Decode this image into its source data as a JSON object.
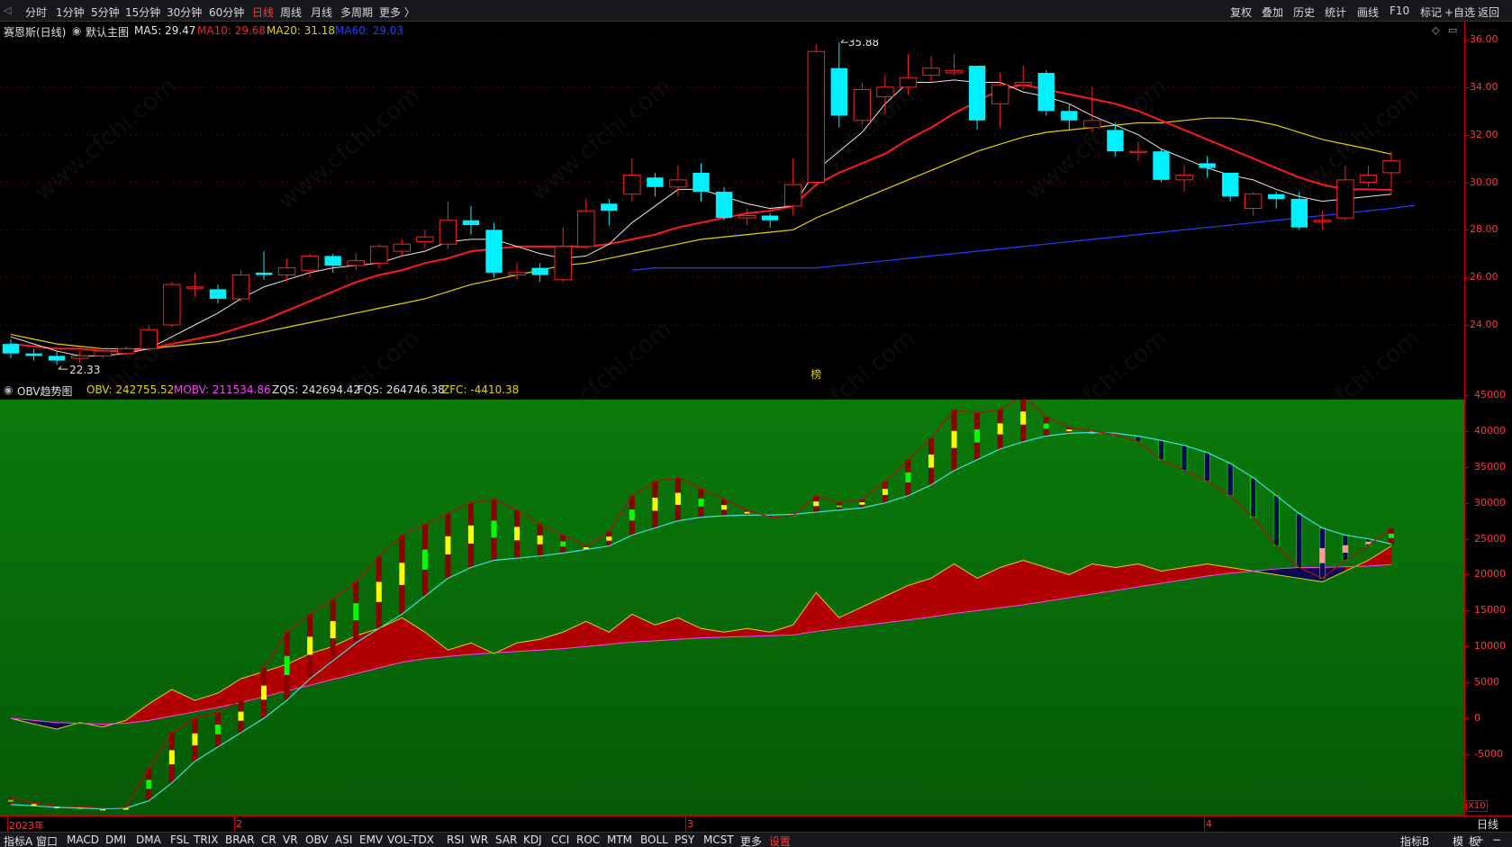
{
  "toolbar": {
    "periods": [
      "分时",
      "1分钟",
      "5分钟",
      "15分钟",
      "30分钟",
      "60分钟",
      "日线",
      "周线",
      "月线",
      "多周期",
      "更多 〉"
    ],
    "active_period": "日线",
    "right_items": [
      "复权",
      "叠加",
      "历史",
      "统计",
      "画线",
      "F10",
      "标记",
      "+自选",
      "返回"
    ]
  },
  "main_info": {
    "stock": "赛恩斯(日线)",
    "template": "默认主图",
    "ma5": "MA5: 29.47",
    "ma10": "MA10: 29.68",
    "ma20": "MA20: 31.18",
    "ma60": "MA60: 29.03"
  },
  "sub_info": {
    "name": "OBV趋势图",
    "obv": "OBV: 242755.52",
    "mobv": "MOBV: 211534.86",
    "zqs": "ZQS: 242694.42",
    "fqs": "FQS: 264746.38",
    "zfc": "ZFC: -4410.38"
  },
  "annotations": {
    "high": "35.88",
    "low": "22.33",
    "marker": "榜"
  },
  "watermark": "www.cfchi.com",
  "colors": {
    "up": "#ff2020",
    "down": "#00f0ff",
    "ma5": "#e6e6e6",
    "ma10": "#ff1a1a",
    "ma20": "#e6d200",
    "ma60": "#2040ff",
    "obv_bg_top": "#0a7a0a",
    "obv_bg_bottom": "#055a05",
    "obv_fill": "#b00000",
    "zqs": "#40e0e0",
    "fqs": "#b01010",
    "bar_yellow": "#ffff00",
    "bar_green": "#00ff00",
    "bar_darkred": "#8b0000",
    "bar_navy": "#0a0a50",
    "bar_pink": "#ff9a9a"
  },
  "date_axis": [
    "2023年",
    "2",
    "3",
    "4"
  ],
  "bottom": {
    "items": [
      "指标A",
      "窗口",
      "MACD",
      "DMI",
      "DMA",
      "FSL",
      "TRIX",
      "BRAR",
      "CR",
      "VR",
      "OBV",
      "ASI",
      "EMV",
      "VOL-TDX",
      "RSI",
      "WR",
      "SAR",
      "KDJ",
      "CCI",
      "ROC",
      "MTM",
      "BOLL",
      "PSY",
      "MCST",
      "更多",
      "设置"
    ],
    "active": "设置",
    "right_items": [
      "指标B",
      "模",
      "板",
      "+",
      "−"
    ],
    "day_button": "日线",
    "x10": "X10"
  },
  "chart_data": [
    {
      "type": "candlestick",
      "title": "赛恩斯(日线)",
      "ylim": [
        22,
        36.5
      ],
      "y_ticks": [
        24.0,
        26.0,
        28.0,
        30.0,
        32.0,
        34.0,
        36.0
      ],
      "y_tick_labels": [
        "24.00",
        "26.00",
        "28.00",
        "30.00",
        "32.00",
        "34.00",
        "36.00"
      ],
      "candles": [
        [
          23.2,
          22.8,
          23.4,
          22.6
        ],
        [
          22.8,
          22.7,
          23.0,
          22.5
        ],
        [
          22.7,
          22.5,
          22.9,
          22.33
        ],
        [
          22.6,
          22.7,
          22.9,
          22.4
        ],
        [
          22.7,
          22.9,
          23.0,
          22.6
        ],
        [
          22.8,
          23.0,
          23.1,
          22.7
        ],
        [
          23.0,
          23.8,
          24.0,
          22.9
        ],
        [
          24.0,
          25.7,
          25.8,
          23.9
        ],
        [
          25.6,
          25.6,
          26.2,
          25.2
        ],
        [
          25.5,
          25.1,
          25.7,
          24.9
        ],
        [
          25.1,
          26.1,
          26.3,
          25.0
        ],
        [
          26.2,
          26.1,
          27.1,
          25.9
        ],
        [
          26.1,
          26.4,
          26.8,
          25.8
        ],
        [
          26.3,
          26.9,
          27.0,
          26.0
        ],
        [
          26.9,
          26.5,
          27.0,
          26.2
        ],
        [
          26.5,
          26.7,
          27.0,
          26.3
        ],
        [
          26.6,
          27.3,
          27.4,
          26.4
        ],
        [
          27.1,
          27.4,
          27.6,
          26.9
        ],
        [
          27.5,
          27.7,
          28.0,
          27.2
        ],
        [
          27.4,
          28.4,
          29.2,
          27.2
        ],
        [
          28.4,
          28.2,
          29.0,
          27.8
        ],
        [
          28.0,
          26.2,
          28.3,
          26.0
        ],
        [
          26.1,
          26.2,
          26.6,
          25.9
        ],
        [
          26.4,
          26.1,
          26.6,
          25.8
        ],
        [
          25.9,
          27.3,
          28.1,
          25.8
        ],
        [
          27.3,
          28.8,
          29.3,
          27.2
        ],
        [
          29.1,
          28.8,
          29.3,
          28.2
        ],
        [
          29.5,
          30.3,
          31.0,
          29.2
        ],
        [
          30.2,
          29.8,
          30.4,
          29.4
        ],
        [
          29.8,
          30.1,
          30.7,
          29.4
        ],
        [
          30.4,
          29.6,
          30.8,
          29.2
        ],
        [
          29.6,
          28.5,
          29.8,
          28.4
        ],
        [
          28.5,
          28.6,
          28.9,
          28.2
        ],
        [
          28.6,
          28.4,
          28.7,
          28.1
        ],
        [
          29.0,
          29.9,
          31.0,
          28.6
        ],
        [
          30.0,
          35.5,
          35.8,
          29.8
        ],
        [
          34.8,
          32.8,
          35.88,
          32.3
        ],
        [
          32.6,
          33.9,
          34.2,
          32.4
        ],
        [
          33.6,
          34.0,
          34.5,
          32.9
        ],
        [
          34.0,
          34.4,
          35.4,
          33.7
        ],
        [
          34.5,
          34.8,
          35.3,
          34.2
        ],
        [
          34.6,
          34.7,
          35.4,
          34.5
        ],
        [
          34.9,
          32.6,
          34.9,
          32.2
        ],
        [
          33.3,
          34.1,
          34.6,
          32.3
        ],
        [
          34.1,
          34.2,
          34.9,
          33.9
        ],
        [
          34.6,
          33.0,
          34.7,
          32.8
        ],
        [
          33.0,
          32.6,
          33.3,
          32.2
        ],
        [
          32.3,
          32.6,
          34.0,
          32.1
        ],
        [
          32.2,
          31.3,
          32.5,
          31.1
        ],
        [
          31.3,
          31.3,
          31.7,
          30.9
        ],
        [
          31.3,
          30.1,
          31.4,
          30.0
        ],
        [
          30.1,
          30.3,
          30.7,
          29.6
        ],
        [
          30.8,
          30.6,
          31.1,
          30.2
        ],
        [
          30.4,
          29.4,
          30.4,
          29.2
        ],
        [
          28.9,
          29.5,
          29.6,
          28.6
        ],
        [
          29.5,
          29.3,
          29.6,
          28.9
        ],
        [
          29.3,
          28.1,
          29.6,
          28.0
        ],
        [
          28.4,
          28.4,
          28.8,
          28.0
        ],
        [
          28.5,
          30.1,
          30.7,
          28.4
        ],
        [
          30.0,
          30.3,
          30.7,
          29.8
        ],
        [
          30.4,
          30.9,
          31.3,
          29.5
        ]
      ],
      "ma5": [
        23.5,
        23.2,
        22.9,
        22.7,
        22.7,
        22.8,
        23.0,
        23.5,
        24.0,
        24.5,
        25.1,
        25.6,
        25.9,
        26.2,
        26.4,
        26.5,
        26.6,
        26.9,
        27.1,
        27.5,
        27.6,
        27.6,
        27.3,
        27.0,
        26.8,
        26.9,
        27.4,
        28.3,
        29.0,
        29.7,
        29.7,
        29.4,
        29.1,
        28.9,
        29.0,
        30.5,
        31.3,
        32.1,
        33.3,
        34.2,
        34.2,
        34.3,
        34.2,
        34.2,
        33.8,
        33.6,
        33.3,
        32.8,
        32.4,
        32.0,
        31.4,
        31.0,
        30.6,
        30.3,
        30.1,
        29.7,
        29.4,
        29.2,
        29.3,
        29.4,
        29.5
      ],
      "ma10": [
        23.2,
        23.1,
        23.0,
        23.0,
        22.9,
        22.9,
        23.0,
        23.2,
        23.4,
        23.6,
        23.9,
        24.2,
        24.6,
        25.0,
        25.4,
        25.8,
        26.1,
        26.3,
        26.6,
        26.8,
        27.1,
        27.2,
        27.3,
        27.3,
        27.3,
        27.3,
        27.4,
        27.6,
        27.8,
        28.1,
        28.3,
        28.5,
        28.7,
        28.8,
        29.0,
        29.9,
        30.4,
        30.8,
        31.2,
        31.8,
        32.3,
        32.9,
        33.4,
        33.9,
        34.1,
        33.9,
        33.7,
        33.5,
        33.3,
        33.0,
        32.6,
        32.2,
        31.8,
        31.4,
        31.0,
        30.6,
        30.2,
        29.9,
        29.7,
        29.7,
        29.68
      ],
      "ma20": [
        23.6,
        23.4,
        23.2,
        23.1,
        23.0,
        23.0,
        23.0,
        23.1,
        23.2,
        23.3,
        23.5,
        23.7,
        23.9,
        24.1,
        24.3,
        24.5,
        24.7,
        24.9,
        25.1,
        25.4,
        25.7,
        25.9,
        26.1,
        26.3,
        26.5,
        26.6,
        26.8,
        27.0,
        27.2,
        27.4,
        27.6,
        27.7,
        27.8,
        27.9,
        28.0,
        28.5,
        28.9,
        29.3,
        29.7,
        30.1,
        30.5,
        30.9,
        31.3,
        31.6,
        31.9,
        32.1,
        32.2,
        32.3,
        32.4,
        32.5,
        32.5,
        32.6,
        32.7,
        32.7,
        32.6,
        32.4,
        32.1,
        31.8,
        31.6,
        31.4,
        31.18
      ],
      "ma60_start": 27,
      "ma60": [
        26.3,
        26.4,
        26.4,
        26.4,
        26.4,
        26.4,
        26.4,
        26.4,
        26.4,
        26.5,
        26.6,
        26.7,
        26.8,
        26.9,
        27.0,
        27.1,
        27.2,
        27.3,
        27.4,
        27.5,
        27.6,
        27.7,
        27.8,
        27.9,
        28.0,
        28.1,
        28.2,
        28.3,
        28.4,
        28.5,
        28.6,
        28.7,
        28.8,
        28.9,
        29.03
      ]
    },
    {
      "type": "indicator",
      "title": "OBV趋势图",
      "ylim": [
        -14000,
        45000
      ],
      "y_ticks": [
        -5000,
        0,
        5000,
        10000,
        15000,
        20000,
        25000,
        30000,
        35000,
        40000,
        45000
      ],
      "y_tick_labels": [
        "-5000",
        "0",
        "5000",
        "10000",
        "15000",
        "20000",
        "25000",
        "30000",
        "35000",
        "40000",
        "45000"
      ],
      "obv": [
        0,
        -800,
        -1500,
        -600,
        -1200,
        -300,
        2000,
        4000,
        2500,
        3500,
        5500,
        6500,
        7500,
        9000,
        10000,
        11500,
        12500,
        14000,
        12000,
        9500,
        10500,
        9000,
        10500,
        11000,
        12000,
        13500,
        12000,
        14500,
        13000,
        14000,
        12500,
        12000,
        12500,
        12000,
        13000,
        17500,
        14000,
        15500,
        17000,
        18500,
        19500,
        21500,
        19500,
        21000,
        22000,
        21000,
        20000,
        21500,
        21000,
        21500,
        20500,
        21000,
        21500,
        21000,
        20500,
        20000,
        19500,
        19000,
        20500,
        22000,
        24000
      ],
      "mobv": [
        0,
        -300,
        -600,
        -700,
        -800,
        -700,
        -300,
        300,
        900,
        1500,
        2200,
        3000,
        3800,
        4600,
        5400,
        6200,
        7000,
        7800,
        8300,
        8600,
        8900,
        9100,
        9300,
        9500,
        9700,
        10000,
        10300,
        10600,
        10800,
        11000,
        11200,
        11300,
        11400,
        11500,
        11600,
        12100,
        12500,
        12900,
        13300,
        13700,
        14100,
        14600,
        15000,
        15400,
        15800,
        16300,
        16800,
        17300,
        17800,
        18300,
        18800,
        19300,
        19800,
        20200,
        20500,
        20800,
        21000,
        21000,
        21100,
        21200,
        21400
      ],
      "zqs": [
        -12000,
        -12200,
        -12400,
        -12500,
        -12600,
        -12500,
        -11500,
        -9000,
        -6000,
        -4000,
        -2000,
        0,
        2500,
        5500,
        8000,
        10500,
        12500,
        14500,
        17000,
        19500,
        21000,
        22000,
        22300,
        22600,
        23000,
        23500,
        24000,
        25500,
        26500,
        27500,
        28000,
        28200,
        28300,
        28300,
        28400,
        28700,
        29000,
        29300,
        30000,
        31000,
        32500,
        34500,
        36000,
        37500,
        38500,
        39300,
        39700,
        39800,
        39700,
        39300,
        38700,
        38000,
        37000,
        35500,
        33500,
        31000,
        28500,
        26500,
        25500,
        25000,
        24269
      ],
      "fqs": [
        -11000,
        -11800,
        -12200,
        -12300,
        -12500,
        -12400,
        -7000,
        -2000,
        0,
        800,
        2500,
        7000,
        12000,
        14500,
        16500,
        19000,
        22500,
        25500,
        27000,
        28500,
        30000,
        30500,
        29000,
        27000,
        25500,
        24000,
        26000,
        31000,
        33000,
        33500,
        32000,
        30500,
        29000,
        28000,
        28200,
        31000,
        30000,
        30500,
        33000,
        36000,
        39000,
        43000,
        42500,
        43000,
        45000,
        42000,
        40500,
        40000,
        39500,
        38500,
        36000,
        34500,
        33000,
        31000,
        28000,
        24000,
        21000,
        19500,
        22000,
        24000,
        26475
      ]
    }
  ]
}
